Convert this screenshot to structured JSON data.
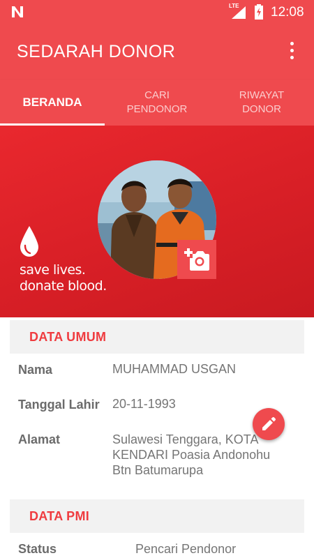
{
  "status_bar": {
    "network": "LTE",
    "time": "12:08"
  },
  "app_bar": {
    "title": "SEDARAH DONOR",
    "menu_icon": "more-vert-icon"
  },
  "tabs": [
    {
      "label": "BERANDA",
      "active": true
    },
    {
      "label": "CARI PENDONOR",
      "active": false
    },
    {
      "label": "RIWAYAT DONOR",
      "active": false
    }
  ],
  "banner": {
    "slogan_line1": "save lives.",
    "slogan_line2": "donate blood.",
    "background_color": "#e02329"
  },
  "profile": {
    "camera_icon": "add-photo-icon"
  },
  "data_umum": {
    "header": "DATA UMUM",
    "fields": [
      {
        "label": "Nama",
        "value": "MUHAMMAD USGAN"
      },
      {
        "label": "Tanggal Lahir",
        "value": "20-11-1993"
      },
      {
        "label": "Alamat",
        "value_lines": [
          "Sulawesi Tenggara, KOTA",
          "KENDARI Poasia Andonohu",
          "Btn Batumarupa"
        ]
      }
    ]
  },
  "data_pmi": {
    "header": "DATA PMI",
    "fields": [
      {
        "label": "Status",
        "value": "Pencari Pendonor"
      }
    ]
  },
  "fab": {
    "icon": "edit-icon"
  },
  "colors": {
    "primary": "#ef4a4e",
    "section_title": "#ef3b3f",
    "label": "#6b6b6b",
    "value": "#757575"
  }
}
